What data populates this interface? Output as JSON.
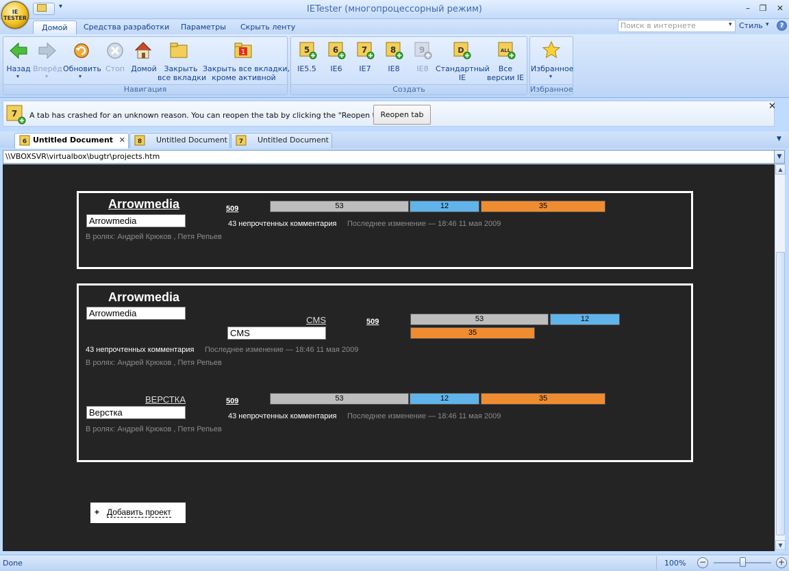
{
  "window": {
    "title": "IETester (многопроцессорный режим)",
    "orb_text": "IE TESTER",
    "controls": {
      "minimize": "–",
      "maximize": "❐",
      "close": "✕"
    }
  },
  "ribbon": {
    "tabs": [
      "Домой",
      "Средства разработки",
      "Параметры",
      "Скрыть ленту"
    ],
    "search_placeholder": "Поиск в интернете",
    "style_label": "Стиль",
    "help": "?",
    "groups": {
      "navigation": {
        "label": "Навигация",
        "back": "Назад",
        "forward": "Вперёд",
        "refresh": "Обновить",
        "stop": "Стоп",
        "home": "Домой",
        "close_all_1": "Закрыть",
        "close_all_2": "все вкладки",
        "close_others_1": "Закрыть все вкладки,",
        "close_others_2": "кроме активной",
        "close_others_badge": "1"
      },
      "create": {
        "label": "Создать",
        "ie55": "IE5.5",
        "ie55_badge": "5",
        "ie6": "IE6",
        "ie6_badge": "6",
        "ie7": "IE7",
        "ie7_badge": "7",
        "ie8": "IE8",
        "ie8_badge": "8",
        "ie9": "IE8",
        "ie9_badge": "9",
        "default_1": "Стандартный",
        "default_2": "IE",
        "default_badge": "D",
        "all_1": "Все",
        "all_2": "версии IE",
        "all_badge": "ALL"
      },
      "favorites": {
        "label": "Избранное",
        "button": "Избранное"
      }
    }
  },
  "infobar": {
    "icon_badge": "7",
    "message": "A tab has crashed for an unknown reason. You can reopen the tab by clicking the \"Reopen tab\" button",
    "button": "Reopen tab",
    "close": "✕"
  },
  "doc_tabs": [
    {
      "label": "Untitled Document",
      "badge": "6",
      "close": "✕"
    },
    {
      "label": "Untitled Document",
      "badge": "8"
    },
    {
      "label": "Untitled Document",
      "badge": "7"
    }
  ],
  "address": "\\\\VBOXSVR\\virtualbox\\bugtr\\projects.htm",
  "page": {
    "card1": {
      "name": "Arrowmedia",
      "field": "Arrowmedia",
      "roles": "В ролях: Андрей Крюков , Петя Репьев",
      "count": "509",
      "bars": {
        "gray": "53",
        "blue": "12",
        "orange": "35"
      },
      "unread": "43 непрочтенных комментария",
      "modified": "Последнее изменение — 18:46 11 мая 2009"
    },
    "card2": {
      "name": "Arrowmedia",
      "field": "Arrowmedia",
      "unread": "43 непрочтенных комментария",
      "modified": "Последнее изменение — 18:46 11 мая 2009",
      "roles": "В ролях: Андрей Крюков , Петя Репьев",
      "sub1": {
        "name": "CMS",
        "field": "CMS",
        "count": "509",
        "bars": {
          "gray": "53",
          "blue": "12",
          "orange": "35"
        }
      },
      "sub2": {
        "name": "ВЕРСТКА",
        "field": "Верстка",
        "count": "509",
        "bars": {
          "gray": "53",
          "blue": "12",
          "orange": "35"
        },
        "unread": "43 непрочтенных комментария",
        "modified": "Последнее изменение — 18:46 11 мая 2009",
        "roles": "В ролях: Андрей Крюков , Петя Репьев"
      }
    },
    "add_project": {
      "plus": "+",
      "label": "Добавить проект"
    }
  },
  "status": {
    "text": "Done",
    "zoom": "100%",
    "zoom_out": "−",
    "zoom_in": "+"
  }
}
